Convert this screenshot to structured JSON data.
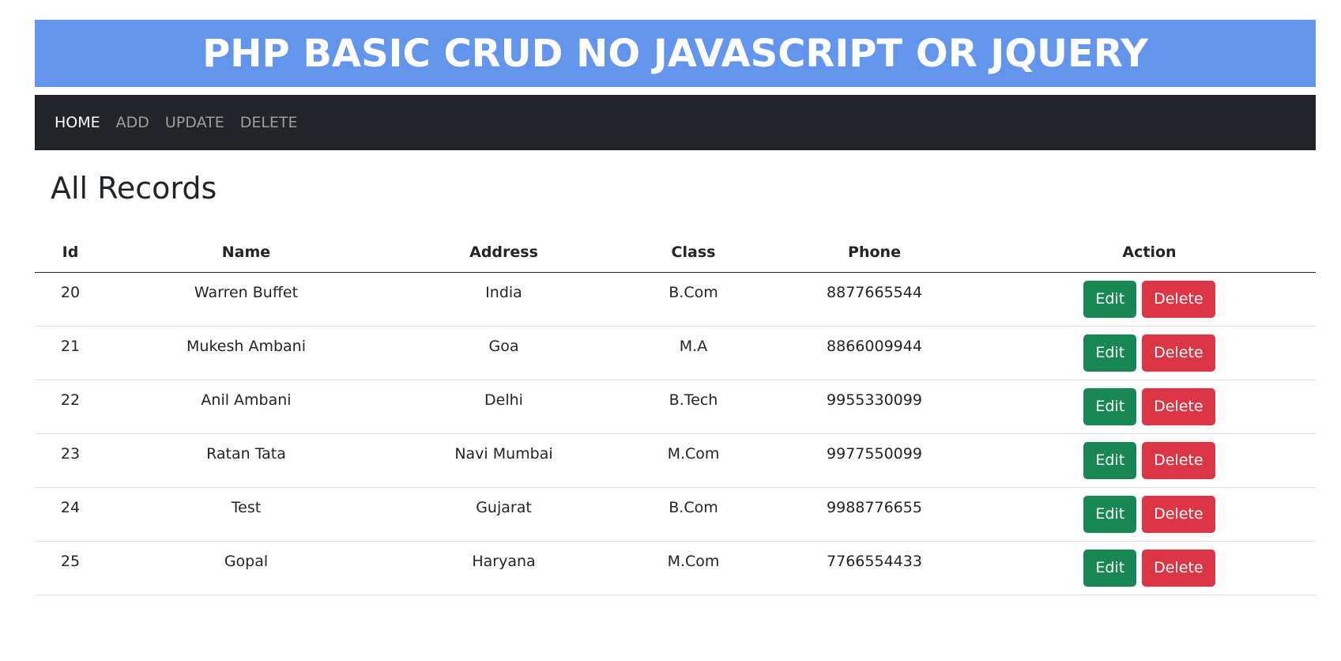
{
  "banner": {
    "title": "PHP BASIC CRUD NO JAVASCRIPT OR JQUERY"
  },
  "nav": {
    "items": [
      {
        "label": "HOME",
        "active": true
      },
      {
        "label": "ADD",
        "active": false
      },
      {
        "label": "UPDATE",
        "active": false
      },
      {
        "label": "DELETE",
        "active": false
      }
    ]
  },
  "page": {
    "title": "All Records"
  },
  "table": {
    "headers": {
      "id": "Id",
      "name": "Name",
      "address": "Address",
      "class": "Class",
      "phone": "Phone",
      "action": "Action"
    },
    "rows": [
      {
        "id": "20",
        "name": "Warren Buffet",
        "address": "India",
        "class": "B.Com",
        "phone": "8877665544"
      },
      {
        "id": "21",
        "name": "Mukesh Ambani",
        "address": "Goa",
        "class": "M.A",
        "phone": "8866009944"
      },
      {
        "id": "22",
        "name": "Anil Ambani",
        "address": "Delhi",
        "class": "B.Tech",
        "phone": "9955330099"
      },
      {
        "id": "23",
        "name": "Ratan Tata",
        "address": "Navi Mumbai",
        "class": "M.Com",
        "phone": "9977550099"
      },
      {
        "id": "24",
        "name": "Test",
        "address": "Gujarat",
        "class": "B.Com",
        "phone": "9988776655"
      },
      {
        "id": "25",
        "name": "Gopal",
        "address": "Haryana",
        "class": "M.Com",
        "phone": "7766554433"
      }
    ],
    "edit_label": "Edit",
    "delete_label": "Delete"
  },
  "colors": {
    "banner": "#6495ed",
    "navbar": "#212529",
    "edit": "#198754",
    "delete": "#dc3545"
  }
}
